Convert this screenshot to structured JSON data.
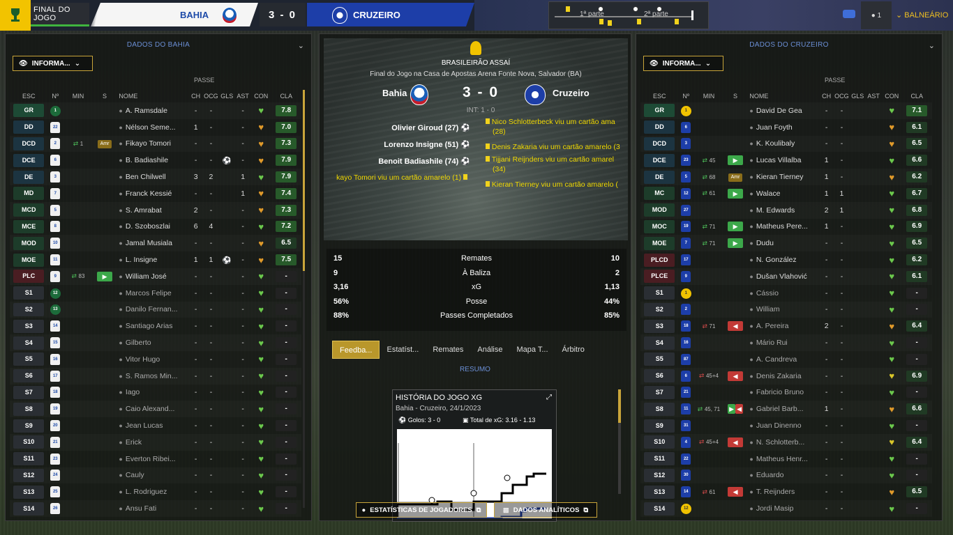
{
  "header": {
    "status": "FINAL DO JOGO",
    "home_team": "BAHIA",
    "away_team": "CRUZEIRO",
    "score": "3 - 0",
    "first_half": "1ª parte",
    "second_half": "2ª parte",
    "user_count": "1",
    "balneario": "BALNEÁRIO"
  },
  "left_panel": {
    "title": "DADOS DO BAHIA",
    "info_button": "INFORMA...",
    "passe_label": "PASSE",
    "columns": [
      "ESC",
      "Nº",
      "MIN",
      "S",
      "NOME",
      "CH",
      "OCG",
      "GLS",
      "AST",
      "CON",
      "CLA"
    ],
    "players": [
      {
        "pos": "GR",
        "num": "1",
        "min": "",
        "s": "",
        "name": "A. Ramsdale",
        "ch": "-",
        "ocg": "-",
        "gls": "",
        "ast": "-",
        "cla": "7.8"
      },
      {
        "pos": "DD",
        "num": "22",
        "min": "",
        "s": "",
        "name": "Nélson Seme...",
        "ch": "1",
        "ocg": "-",
        "gls": "",
        "ast": "-",
        "cla": "7.0"
      },
      {
        "pos": "DCD",
        "num": "2",
        "min": "1",
        "s": "Amr",
        "name": "Fikayo Tomori",
        "ch": "-",
        "ocg": "-",
        "gls": "",
        "ast": "-",
        "cla": "7.3"
      },
      {
        "pos": "DCE",
        "num": "6",
        "min": "",
        "s": "",
        "name": "B. Badiashile",
        "ch": "-",
        "ocg": "-",
        "gls": "⚽",
        "ast": "-",
        "cla": "7.9"
      },
      {
        "pos": "DE",
        "num": "3",
        "min": "",
        "s": "",
        "name": "Ben Chilwell",
        "ch": "3",
        "ocg": "2",
        "gls": "",
        "ast": "1",
        "cla": "7.9"
      },
      {
        "pos": "MD",
        "num": "7",
        "min": "",
        "s": "",
        "name": "Franck Kessié",
        "ch": "-",
        "ocg": "-",
        "gls": "",
        "ast": "1",
        "cla": "7.4"
      },
      {
        "pos": "MCD",
        "num": "5",
        "min": "",
        "s": "",
        "name": "S. Amrabat",
        "ch": "2",
        "ocg": "-",
        "gls": "",
        "ast": "-",
        "cla": "7.3"
      },
      {
        "pos": "MCE",
        "num": "8",
        "min": "",
        "s": "",
        "name": "D. Szoboszlai",
        "ch": "6",
        "ocg": "4",
        "gls": "",
        "ast": "-",
        "cla": "7.2"
      },
      {
        "pos": "MOD",
        "num": "10",
        "min": "",
        "s": "",
        "name": "Jamal Musiala",
        "ch": "-",
        "ocg": "-",
        "gls": "",
        "ast": "-",
        "cla": "6.5"
      },
      {
        "pos": "MOE",
        "num": "11",
        "min": "",
        "s": "",
        "name": "L. Insigne",
        "ch": "1",
        "ocg": "1",
        "gls": "⚽",
        "ast": "-",
        "cla": "7.5"
      },
      {
        "pos": "PLC",
        "num": "9",
        "min": "83",
        "s": "",
        "name": "William José",
        "ch": "-",
        "ocg": "-",
        "gls": "",
        "ast": "-",
        "cla": "-"
      },
      {
        "pos": "S1",
        "num": "12",
        "min": "",
        "s": "",
        "name": "Marcos Felipe",
        "ch": "-",
        "ocg": "-",
        "gls": "",
        "ast": "-",
        "cla": "-"
      },
      {
        "pos": "S2",
        "num": "13",
        "min": "",
        "s": "",
        "name": "Danilo Fernan...",
        "ch": "-",
        "ocg": "-",
        "gls": "",
        "ast": "-",
        "cla": "-"
      },
      {
        "pos": "S3",
        "num": "14",
        "min": "",
        "s": "",
        "name": "Santiago Arias",
        "ch": "-",
        "ocg": "-",
        "gls": "",
        "ast": "-",
        "cla": "-"
      },
      {
        "pos": "S4",
        "num": "15",
        "min": "",
        "s": "",
        "name": "Gilberto",
        "ch": "-",
        "ocg": "-",
        "gls": "",
        "ast": "-",
        "cla": "-"
      },
      {
        "pos": "S5",
        "num": "16",
        "min": "",
        "s": "",
        "name": "Vitor Hugo",
        "ch": "-",
        "ocg": "-",
        "gls": "",
        "ast": "-",
        "cla": "-"
      },
      {
        "pos": "S6",
        "num": "17",
        "min": "",
        "s": "",
        "name": "S. Ramos Min...",
        "ch": "-",
        "ocg": "-",
        "gls": "",
        "ast": "-",
        "cla": "-"
      },
      {
        "pos": "S7",
        "num": "18",
        "min": "",
        "s": "",
        "name": "Iago",
        "ch": "-",
        "ocg": "-",
        "gls": "",
        "ast": "-",
        "cla": "-"
      },
      {
        "pos": "S8",
        "num": "19",
        "min": "",
        "s": "",
        "name": "Caio Alexand...",
        "ch": "-",
        "ocg": "-",
        "gls": "",
        "ast": "-",
        "cla": "-"
      },
      {
        "pos": "S9",
        "num": "20",
        "min": "",
        "s": "",
        "name": "Jean Lucas",
        "ch": "-",
        "ocg": "-",
        "gls": "",
        "ast": "-",
        "cla": "-"
      },
      {
        "pos": "S10",
        "num": "21",
        "min": "",
        "s": "",
        "name": "Erick",
        "ch": "-",
        "ocg": "-",
        "gls": "",
        "ast": "-",
        "cla": "-"
      },
      {
        "pos": "S11",
        "num": "23",
        "min": "",
        "s": "",
        "name": "Everton Ribei...",
        "ch": "-",
        "ocg": "-",
        "gls": "",
        "ast": "-",
        "cla": "-"
      },
      {
        "pos": "S12",
        "num": "24",
        "min": "",
        "s": "",
        "name": "Cauly",
        "ch": "-",
        "ocg": "-",
        "gls": "",
        "ast": "-",
        "cla": "-"
      },
      {
        "pos": "S13",
        "num": "25",
        "min": "",
        "s": "",
        "name": "L. Rodriguez",
        "ch": "-",
        "ocg": "-",
        "gls": "",
        "ast": "-",
        "cla": "-"
      },
      {
        "pos": "S14",
        "num": "26",
        "min": "",
        "s": "",
        "name": "Ansu Fati",
        "ch": "-",
        "ocg": "-",
        "gls": "",
        "ast": "-",
        "cla": "-"
      }
    ]
  },
  "right_panel": {
    "title": "DADOS DO CRUZEIRO",
    "info_button": "INFORMA...",
    "passe_label": "PASSE",
    "columns": [
      "ESC",
      "Nº",
      "MIN",
      "S",
      "NOME",
      "CH",
      "OCG",
      "GLS",
      "AST",
      "CON",
      "CLA"
    ],
    "players": [
      {
        "pos": "GR",
        "num": "1",
        "min": "",
        "s": "",
        "name": "David De Gea",
        "ch": "-",
        "ocg": "-",
        "cla": "7.1"
      },
      {
        "pos": "DD",
        "num": "6",
        "min": "",
        "s": "",
        "name": "Juan Foyth",
        "ch": "-",
        "ocg": "-",
        "cla": "6.1"
      },
      {
        "pos": "DCD",
        "num": "3",
        "min": "",
        "s": "",
        "name": "K. Koulibaly",
        "ch": "-",
        "ocg": "-",
        "cla": "6.5"
      },
      {
        "pos": "DCE",
        "num": "23",
        "min": "45",
        "s": "in",
        "name": "Lucas Villalba",
        "ch": "1",
        "ocg": "-",
        "cla": "6.6"
      },
      {
        "pos": "DE",
        "num": "5",
        "min": "68",
        "s": "Amr",
        "name": "Kieran Tierney",
        "ch": "1",
        "ocg": "-",
        "cla": "6.2"
      },
      {
        "pos": "MC",
        "num": "12",
        "min": "61",
        "s": "in",
        "name": "Walace",
        "ch": "1",
        "ocg": "1",
        "cla": "6.7"
      },
      {
        "pos": "MOD",
        "num": "27",
        "min": "",
        "s": "",
        "name": "M. Edwards",
        "ch": "2",
        "ocg": "1",
        "cla": "6.8"
      },
      {
        "pos": "MOC",
        "num": "19",
        "min": "71",
        "s": "in",
        "name": "Matheus Pere...",
        "ch": "1",
        "ocg": "-",
        "cla": "6.9"
      },
      {
        "pos": "MOE",
        "num": "7",
        "min": "71",
        "s": "in",
        "name": "Dudu",
        "ch": "-",
        "ocg": "-",
        "cla": "6.5"
      },
      {
        "pos": "PLCD",
        "num": "17",
        "min": "",
        "s": "",
        "name": "N. González",
        "ch": "-",
        "ocg": "-",
        "cla": "6.2"
      },
      {
        "pos": "PLCE",
        "num": "9",
        "min": "",
        "s": "",
        "name": "Dušan Vlahović",
        "ch": "-",
        "ocg": "-",
        "cla": "6.1"
      },
      {
        "pos": "S1",
        "num": "1",
        "min": "",
        "s": "",
        "name": "Cássio",
        "ch": "-",
        "ocg": "-",
        "cla": "-"
      },
      {
        "pos": "S2",
        "num": "2",
        "min": "",
        "s": "",
        "name": "William",
        "ch": "-",
        "ocg": "-",
        "cla": "-"
      },
      {
        "pos": "S3",
        "num": "18",
        "min": "71",
        "s": "out",
        "name": "A. Pereira",
        "ch": "2",
        "ocg": "-",
        "cla": "6.4"
      },
      {
        "pos": "S4",
        "num": "16",
        "min": "",
        "s": "",
        "name": "Mário Rui",
        "ch": "-",
        "ocg": "-",
        "cla": "-"
      },
      {
        "pos": "S5",
        "num": "87",
        "min": "",
        "s": "",
        "name": "A. Candreva",
        "ch": "-",
        "ocg": "-",
        "cla": "-"
      },
      {
        "pos": "S6",
        "num": "6",
        "min": "45+4",
        "s": "out",
        "name": "Denis Zakaria",
        "ch": "-",
        "ocg": "-",
        "cla": "6.9"
      },
      {
        "pos": "S7",
        "num": "21",
        "min": "",
        "s": "",
        "name": "Fabricio Bruno",
        "ch": "-",
        "ocg": "-",
        "cla": "-"
      },
      {
        "pos": "S8",
        "num": "11",
        "min": "45, 71",
        "s": "inout",
        "name": "Gabriel Barb...",
        "ch": "1",
        "ocg": "-",
        "cla": "6.6"
      },
      {
        "pos": "S9",
        "num": "31",
        "min": "",
        "s": "",
        "name": "Juan Dinenno",
        "ch": "-",
        "ocg": "-",
        "cla": "-"
      },
      {
        "pos": "S10",
        "num": "4",
        "min": "45+4",
        "s": "out",
        "name": "N. Schlotterb...",
        "ch": "-",
        "ocg": "-",
        "cla": "6.4"
      },
      {
        "pos": "S11",
        "num": "22",
        "min": "",
        "s": "",
        "name": "Matheus Henr...",
        "ch": "-",
        "ocg": "-",
        "cla": "-"
      },
      {
        "pos": "S12",
        "num": "30",
        "min": "",
        "s": "",
        "name": "Eduardo",
        "ch": "-",
        "ocg": "-",
        "cla": "-"
      },
      {
        "pos": "S13",
        "num": "14",
        "min": "61",
        "s": "out",
        "name": "T. Reijnders",
        "ch": "-",
        "ocg": "-",
        "cla": "6.5"
      },
      {
        "pos": "S14",
        "num": "12",
        "min": "",
        "s": "",
        "name": "Jordi Masip",
        "ch": "-",
        "ocg": "-",
        "cla": "-"
      }
    ]
  },
  "match": {
    "competition": "BRASILEIRÃO ASSAÍ",
    "subtitle": "Final do Jogo na Casa de Apostas Arena Fonte Nova, Salvador (BA)",
    "home": "Bahia",
    "away": "Cruzeiro",
    "score": "3 - 0",
    "interval": "INT: 1 - 0",
    "scorers": [
      "Olivier Giroud (27)",
      "Lorenzo Insigne (51)",
      "Benoit Badiashile (74)"
    ],
    "home_cards": [
      "kayo Tomori viu um cartão amarelo (1)"
    ],
    "away_events": [
      "Nico Schlotterbeck viu um cartão ama",
      "(28)",
      "Denis Zakaria viu um cartão amarelo (3",
      "Tijjani Reijnders viu um cartão amarel",
      "(34)",
      "Kieran Tierney viu um cartão amarelo ("
    ]
  },
  "stats": [
    {
      "home": "15",
      "label": "Remates",
      "away": "10"
    },
    {
      "home": "9",
      "label": "À Baliza",
      "away": "2"
    },
    {
      "home": "3,16",
      "label": "xG",
      "away": "1,13"
    },
    {
      "home": "56%",
      "label": "Posse",
      "away": "44%"
    },
    {
      "home": "88%",
      "label": "Passes Completados",
      "away": "85%"
    }
  ],
  "tabs": [
    "Feedba...",
    "Estatíst...",
    "Remates",
    "Análise",
    "Mapa T...",
    "Árbitro"
  ],
  "resumo": "RESUMO",
  "xg_card": {
    "title": "HISTÓRIA DO JOGO XG",
    "subtitle": "Bahia - Cruzeiro, 24/1/2023",
    "goals": "Golos: 3 - 0",
    "total_xg": "Total de xG: 3.16 - 1.13"
  },
  "buttons": {
    "player_stats": "ESTATÍSTICAS DE JOGADORES",
    "analytics": "DADOS ANALÍTICOS"
  },
  "colors": {
    "accent": "#c9a53a",
    "home": "#1d4aa8",
    "away": "#1d3ea8",
    "rating": "#275a2a"
  }
}
